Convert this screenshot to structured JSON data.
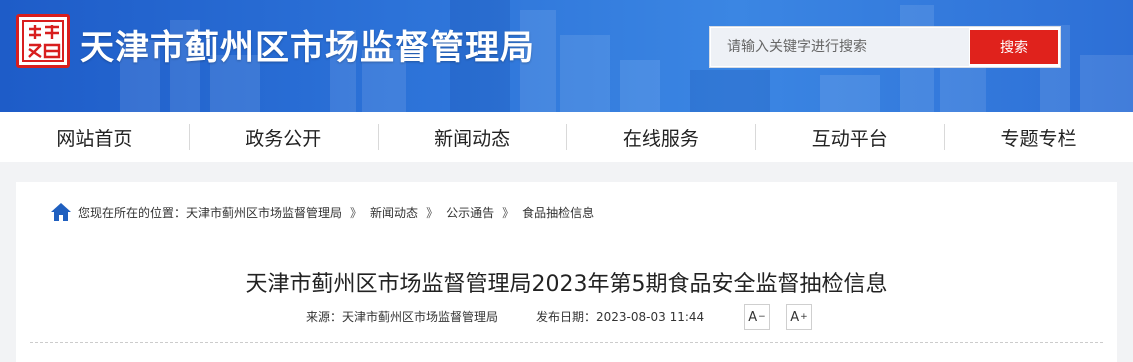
{
  "header": {
    "site_title": "天津市蓟州区市场监督管理局",
    "logo_icon": "seal-logo-icon",
    "search": {
      "placeholder": "请输入关键字进行搜索",
      "value": "",
      "button_label": "搜索"
    }
  },
  "nav": {
    "items": [
      {
        "label": "网站首页"
      },
      {
        "label": "政务公开"
      },
      {
        "label": "新闻动态"
      },
      {
        "label": "在线服务"
      },
      {
        "label": "互动平台"
      },
      {
        "label": "专题专栏"
      }
    ]
  },
  "breadcrumb": {
    "icon": "home-icon",
    "prefix": "您现在所在的位置：",
    "items": [
      {
        "label": "天津市蓟州区市场监督管理局"
      },
      {
        "label": "新闻动态"
      },
      {
        "label": "公示通告"
      },
      {
        "label": "食品抽检信息"
      }
    ],
    "separator": "》"
  },
  "article": {
    "title": "天津市蓟州区市场监督管理局2023年第5期食品安全监督抽检信息",
    "source": "来源：天津市蓟州区市场监督管理局",
    "date": "发布日期：2023-08-03 11:44",
    "font_decrease_label": "A",
    "font_decrease_sign": "−",
    "font_increase_label": "A",
    "font_increase_sign": "+"
  },
  "colors": {
    "banner_blue": "#2c72d8",
    "search_red": "#e0221c",
    "logo_red": "#d81e1e"
  }
}
